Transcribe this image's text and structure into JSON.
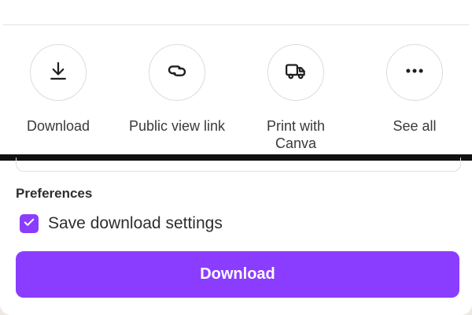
{
  "share_options": [
    {
      "label": "Download",
      "icon": "download-icon"
    },
    {
      "label": "Public view link",
      "icon": "link-icon"
    },
    {
      "label": "Print with\nCanva",
      "icon": "truck-icon"
    },
    {
      "label": "See all",
      "icon": "more-horizontal-icon"
    }
  ],
  "preferences": {
    "title": "Preferences",
    "save_settings_label": "Save download settings",
    "save_settings_checked": true
  },
  "download_button": {
    "label": "Download"
  },
  "colors": {
    "accent": "#8b3dff",
    "divider": "#e3e3e3",
    "text": "#2b2b2b"
  }
}
